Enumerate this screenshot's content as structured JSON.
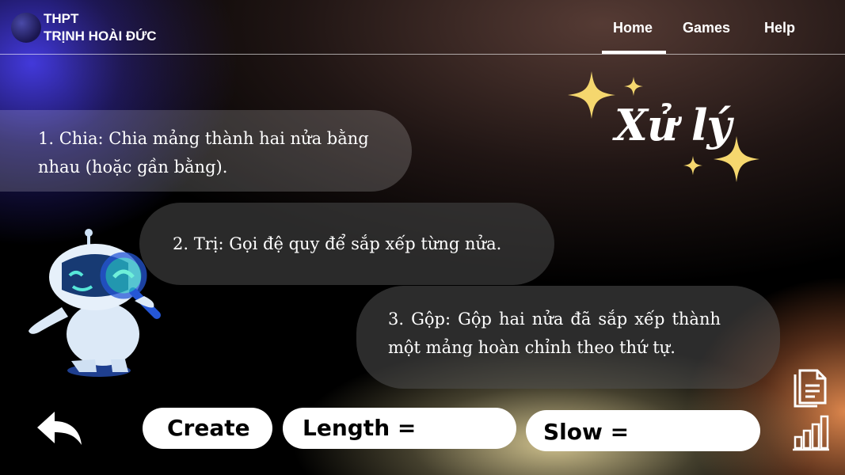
{
  "header": {
    "school_line1": "THPT",
    "school_line2": "TRỊNH HOÀI ĐỨC",
    "nav": [
      {
        "label": "Home",
        "active": true
      },
      {
        "label": "Games",
        "active": false
      },
      {
        "label": "Help",
        "active": false
      }
    ]
  },
  "title": "Xử lý",
  "steps": [
    "1. Chia: Chia mảng thành hai nửa bằng nhau (hoặc gần bằng).",
    "2. Trị: Gọi đệ quy để sắp xếp từng nửa.",
    "3. Gộp: Gộp hai nửa đã sắp xếp thành một mảng hoàn chỉnh theo thứ tự."
  ],
  "controls": {
    "create_label": "Create",
    "length_label": "Length =",
    "slow_label": "Slow ="
  },
  "icons": {
    "logo": "school-logo",
    "back": "back-arrow-icon",
    "document": "document-icon",
    "chart": "bar-chart-icon",
    "mascot": "robot-magnifier-mascot",
    "sparkle": "sparkle-icon"
  },
  "colors": {
    "sparkle": "#f5d76e",
    "bubble": "#ffffff",
    "accent_blue": "#3b3bd6"
  }
}
